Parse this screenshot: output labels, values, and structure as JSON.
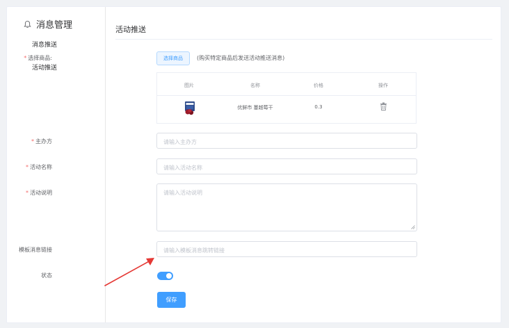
{
  "sidebar": {
    "menu_title": "消息管理",
    "items": [
      {
        "label": "消息推送"
      },
      {
        "label": "活动推送"
      }
    ]
  },
  "page": {
    "title": "活动推送"
  },
  "form": {
    "select_goods_label": "选择商品:",
    "select_goods_button": "选择商品",
    "select_goods_hint": "(购买特定商品后发送活动推送消息)",
    "organizer_label": "主办方",
    "organizer_placeholder": "请输入主办方",
    "activity_name_label": "活动名称",
    "activity_name_placeholder": "请输入活动名称",
    "activity_desc_label": "活动说明",
    "activity_desc_placeholder": "请输入活动说明",
    "template_link_label": "模板消息链接",
    "template_link_placeholder": "请输入模板消息跳转链接",
    "status_label": "状态",
    "status_on": true,
    "save_button": "保存"
  },
  "goods_table": {
    "headers": [
      "图片",
      "名称",
      "价格",
      "操作"
    ],
    "rows": [
      {
        "name": "优鲜市 蔓越莓干",
        "price": "0.3",
        "image_icon": "product-thumbnail",
        "action_icon": "trash-icon"
      }
    ]
  },
  "colors": {
    "primary": "#409eff",
    "required": "#f56c6c",
    "annotation_arrow": "#e53935"
  }
}
